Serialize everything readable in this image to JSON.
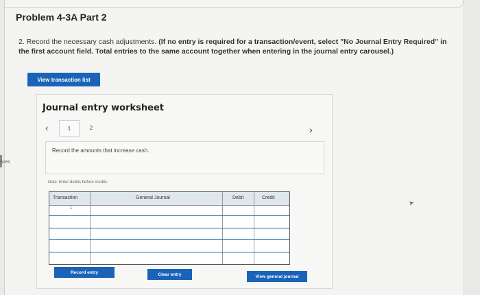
{
  "header": {
    "problem_title": "Problem 4-3A Part 2"
  },
  "instruction": {
    "prefix": "2. Record the necessary cash adjustments.",
    "bold": "(If no entry is required for a transaction/event, select \"No Journal Entry Required\" in the first account field. Total entries to the same account together when entering in the journal entry carousel.)"
  },
  "view_transaction_list": "View transaction list",
  "side_fragment": "nces",
  "worksheet": {
    "title": "Journal entry worksheet",
    "tabs": [
      "1",
      "2"
    ],
    "prompt": "Record the amounts that increase cash.",
    "note": "Note: Enter debits before credits.",
    "table": {
      "columns": [
        "Transaction",
        "General Journal",
        "Debit",
        "Credit"
      ],
      "first_row_number": "1"
    },
    "buttons": {
      "record": "Record entry",
      "clear": "Clear entry",
      "view_general_journal": "View general journal"
    }
  },
  "icons": {
    "prev": "chevron-left-icon",
    "next": "chevron-right-icon",
    "cursor": "mouse-cursor-icon"
  },
  "colors": {
    "accent": "#1a63b8",
    "table_border": "#2366b5",
    "header_bg": "#dfe6ec"
  }
}
